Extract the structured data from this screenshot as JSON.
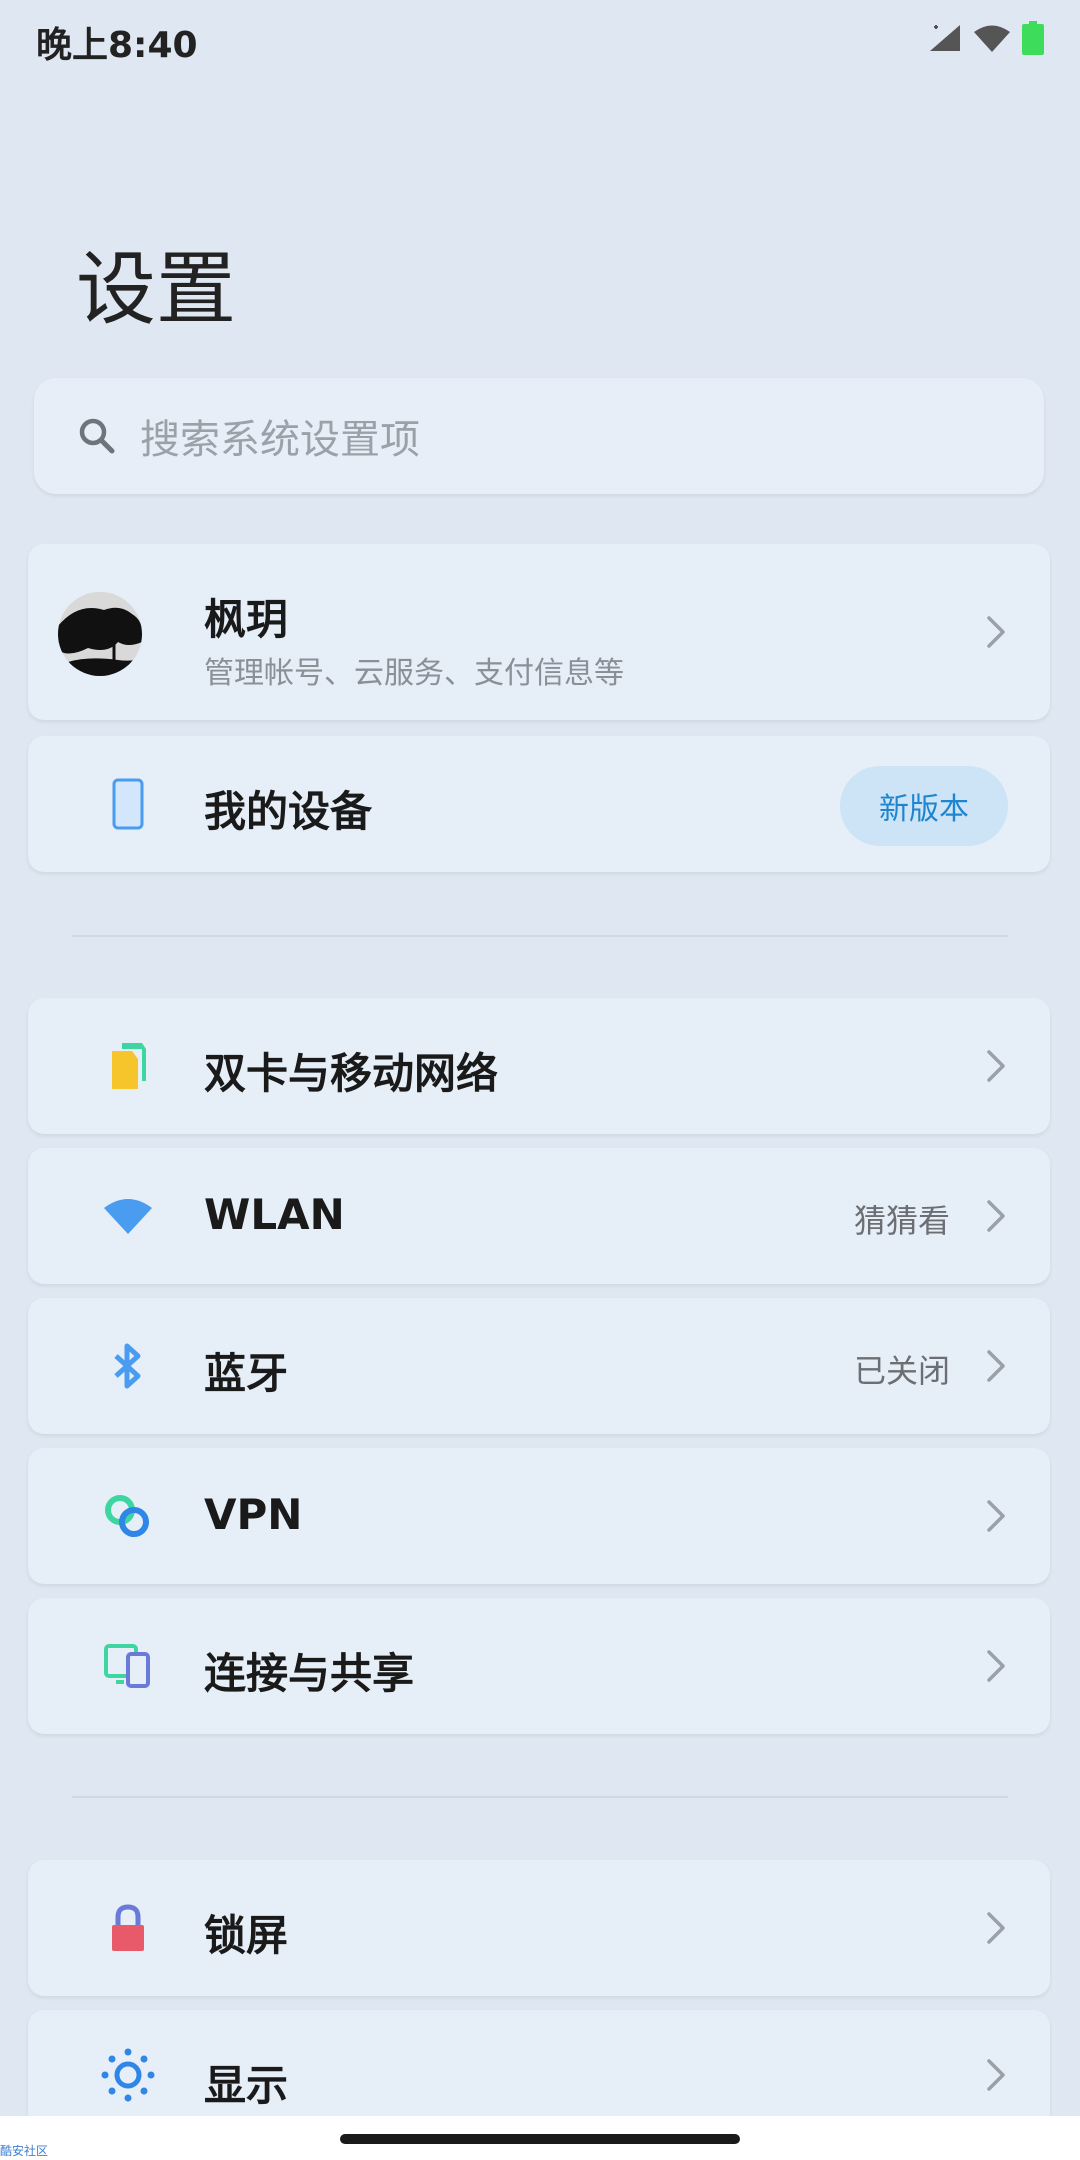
{
  "status_bar": {
    "time": "晚上8:40",
    "icons": [
      "signal-icon",
      "wifi-icon",
      "battery-icon"
    ],
    "battery_color": "#3ddc5a"
  },
  "header": {
    "title": "设置"
  },
  "search": {
    "placeholder": "搜索系统设置项"
  },
  "account": {
    "name": "枫玥",
    "subtitle": "管理帐号、云服务、支付信息等"
  },
  "device": {
    "label": "我的设备",
    "badge": "新版本"
  },
  "network_section": [
    {
      "label": "双卡与移动网络",
      "value": "",
      "icon": "sim-card-icon"
    },
    {
      "label": "WLAN",
      "value": "猜猜看",
      "icon": "wifi-icon"
    },
    {
      "label": "蓝牙",
      "value": "已关闭",
      "icon": "bluetooth-icon"
    },
    {
      "label": "VPN",
      "value": "",
      "icon": "vpn-icon"
    },
    {
      "label": "连接与共享",
      "value": "",
      "icon": "connection-sharing-icon"
    }
  ],
  "display_section": [
    {
      "label": "锁屏",
      "icon": "lock-icon"
    },
    {
      "label": "显示",
      "icon": "brightness-icon"
    }
  ],
  "footer": {
    "watermark": "酷安社区"
  },
  "colors": {
    "background": "#dfe8f2",
    "card": "#e6eef8",
    "accent_blue": "#4a9cf0",
    "badge_bg": "#cde3f6",
    "badge_text": "#1e86d0"
  }
}
